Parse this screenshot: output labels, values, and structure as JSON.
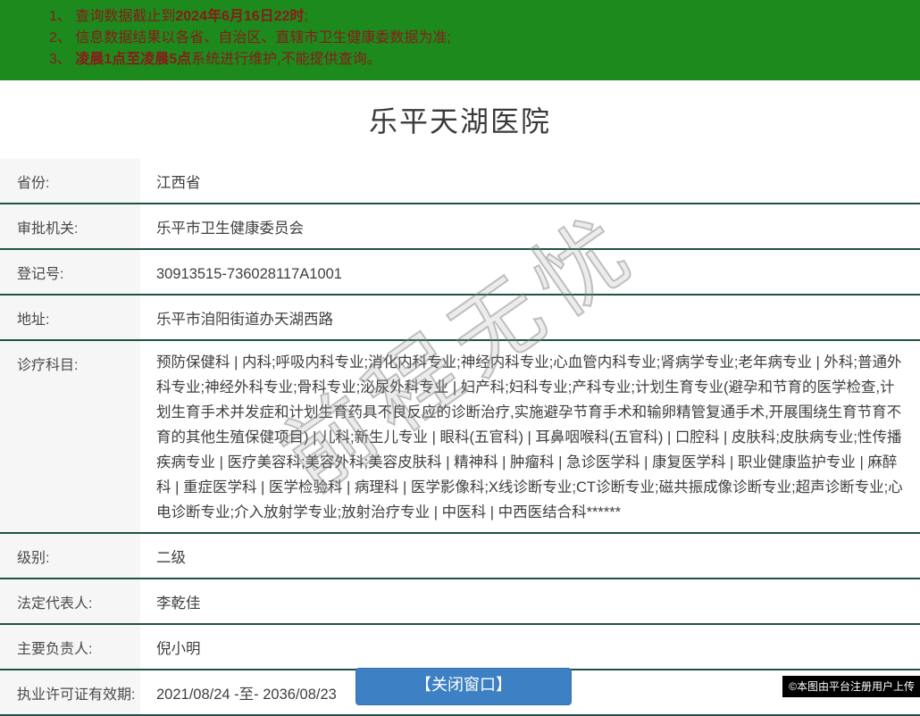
{
  "notice_bar": {
    "bg_color": "#1d8a1d",
    "text_color": "#8b1a1a",
    "items": [
      {
        "prefix": "1、 查询数据截止到",
        "bold": "2024年6月16日22时",
        "suffix": ";"
      },
      {
        "prefix": "2、 信息数据结果以各省、自治区、直辖市卫生健康委数据为准;",
        "bold": "",
        "suffix": ""
      },
      {
        "prefix": "3、 ",
        "bold": "凌晨1点至凌晨5点",
        "suffix": "系统进行维护,不能提供查询。"
      }
    ]
  },
  "page_title": "乐平天湖医院",
  "table": {
    "divider_color": "#1e5247",
    "label_bg_color": "#f6f6f6",
    "rows": [
      {
        "label": "省份:",
        "value": "江西省",
        "tall": false
      },
      {
        "label": "审批机关:",
        "value": "乐平市卫生健康委员会",
        "tall": false
      },
      {
        "label": "登记号:",
        "value": "30913515-736028117A1001",
        "tall": false
      },
      {
        "label": "地址:",
        "value": "乐平市洎阳街道办天湖西路",
        "tall": false
      },
      {
        "label": "诊疗科目:",
        "value": "预防保健科 | 内科;呼吸内科专业;消化内科专业;神经内科专业;心血管内科专业;肾病学专业;老年病专业 | 外科;普通外科专业;神经外科专业;骨科专业;泌尿外科专业 | 妇产科;妇科专业;产科专业;计划生育专业(避孕和节育的医学检查,计划生育手术并发症和计划生育药具不良反应的诊断治疗,实施避孕节育手术和输卵精管复通手术,开展围绕生育节育不育的其他生殖保健项目) | 儿科;新生儿专业 | 眼科(五官科) | 耳鼻咽喉科(五官科) | 口腔科 | 皮肤科;皮肤病专业;性传播疾病专业 | 医疗美容科;美容外科;美容皮肤科 | 精神科 | 肿瘤科 | 急诊医学科 | 康复医学科 | 职业健康监护专业 | 麻醉科 | 重症医学科 | 医学检验科 | 病理科 | 医学影像科;X线诊断专业;CT诊断专业;磁共振成像诊断专业;超声诊断专业;心电诊断专业;介入放射学专业;放射治疗专业 | 中医科 | 中西医结合科******",
        "tall": true
      },
      {
        "label": "级别:",
        "value": "二级",
        "tall": false
      },
      {
        "label": "法定代表人:",
        "value": "李乾佳",
        "tall": false
      },
      {
        "label": "主要负责人:",
        "value": "倪小明",
        "tall": false
      },
      {
        "label": "执业许可证有效期:",
        "value": "2021/08/24 -至- 2036/08/23",
        "tall": false
      }
    ]
  },
  "close_button": {
    "label": "【关闭窗口】",
    "bg_color": "#3d80c4"
  },
  "watermark": {
    "text": "前程无忧"
  },
  "upload_badge": {
    "text": "©本图由平台注册用户上传"
  }
}
